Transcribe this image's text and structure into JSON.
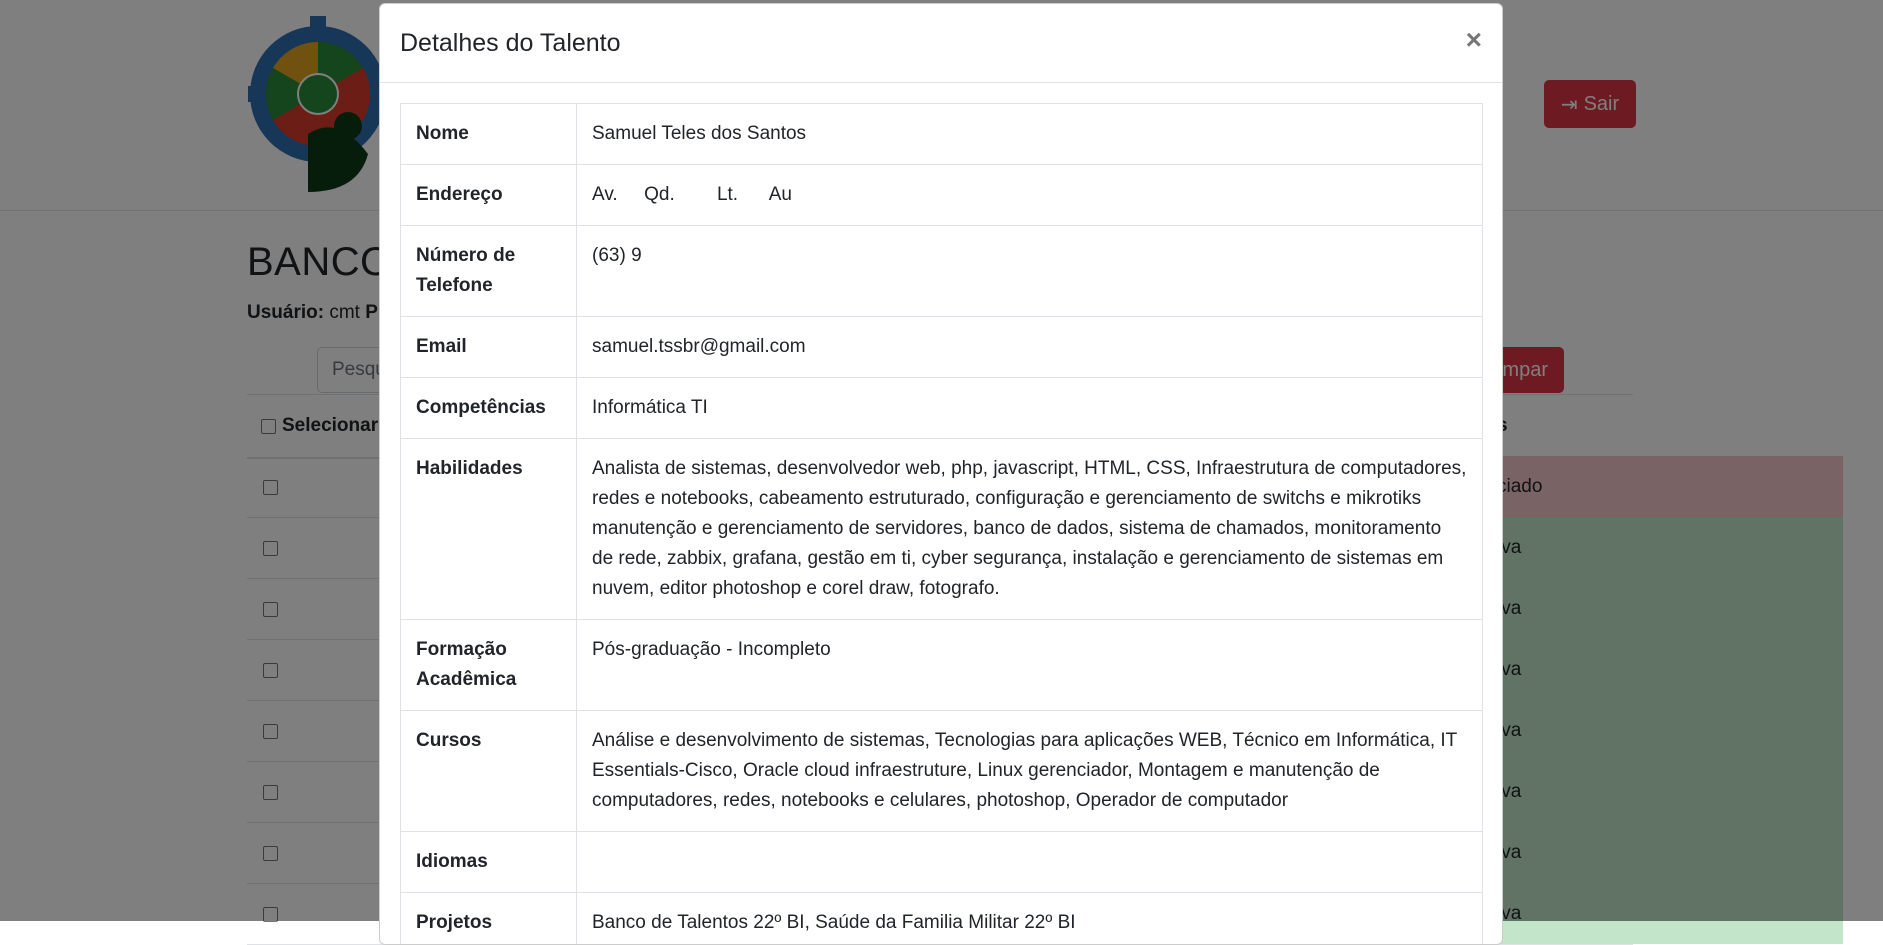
{
  "header": {
    "logout_label": "Sair"
  },
  "page": {
    "title": "BANCO",
    "user_label": "Usuário:",
    "user_value": "cmt",
    "user_trailing": "P",
    "search_placeholder": "Pesqu",
    "clear_label": "mpar"
  },
  "table": {
    "select_header": "Selecionar",
    "status_header": "s",
    "rows": [
      {
        "status": "ciado",
        "kind": "neg"
      },
      {
        "status": "iva",
        "kind": "pos"
      },
      {
        "status": "iva",
        "kind": "pos"
      },
      {
        "status": "iva",
        "kind": "pos"
      },
      {
        "status": "iva",
        "kind": "pos"
      },
      {
        "status": "iva",
        "kind": "pos"
      },
      {
        "status": "iva",
        "kind": "pos"
      },
      {
        "status": "iva",
        "kind": "pos"
      }
    ]
  },
  "modal": {
    "title": "Detalhes do Talento",
    "close": "×",
    "rows": [
      {
        "label": "Nome",
        "value": "Samuel Teles dos Santos"
      },
      {
        "label": "Endereço",
        "value": "Av.     Qd.        Lt.      Au"
      },
      {
        "label": "Número de Telefone",
        "value": "(63) 9"
      },
      {
        "label": "Email",
        "value": "samuel.tssbr@gmail.com"
      },
      {
        "label": "Competências",
        "value": "Informática TI"
      },
      {
        "label": "Habilidades",
        "value": "Analista de sistemas, desenvolvedor web, php, javascript, HTML, CSS, Infraestrutura de computadores, redes e notebooks, cabeamento estruturado, configuração e gerenciamento de switchs e mikrotiks manutenção e gerenciamento de servidores, banco de dados, sistema de chamados, monitoramento de rede, zabbix, grafana, gestão em ti, cyber segurança, instalação e gerenciamento de sistemas em nuvem, editor photoshop e corel draw, fotografo."
      },
      {
        "label": "Formação Acadêmica",
        "value": "Pós-graduação - Incompleto"
      },
      {
        "label": "Cursos",
        "value": "Análise e desenvolvimento de sistemas, Tecnologias para aplicações WEB, Técnico em Informática, IT Essentials-Cisco, Oracle cloud infraestruture, Linux gerenciador, Montagem e manutenção de computadores, redes, notebooks e celulares, photoshop, Operador de computador"
      },
      {
        "label": "Idiomas",
        "value": ""
      },
      {
        "label": "Projetos",
        "value": "Banco de Talentos 22º BI, Saúde da Familia Militar 22º BI"
      }
    ]
  }
}
